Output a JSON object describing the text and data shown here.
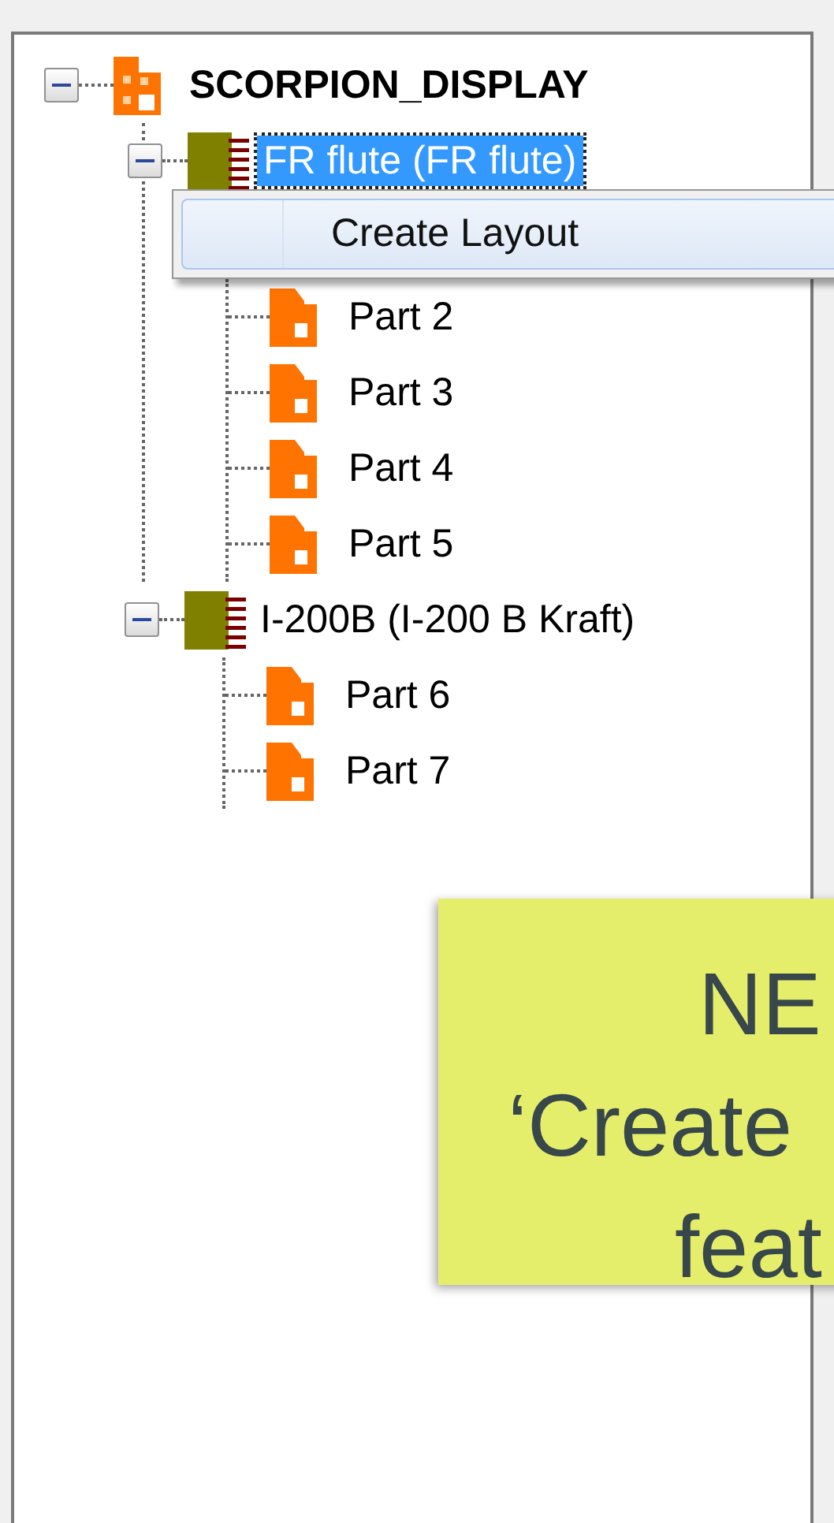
{
  "tree": {
    "label": "SCORPION_DISPLAY",
    "kind": "assembly",
    "expanded": true,
    "selected": false,
    "children": [
      {
        "label": "FR flute (FR flute)",
        "kind": "material",
        "expanded": true,
        "selected": true,
        "children": [
          {
            "label": "Part 2",
            "kind": "part",
            "selected": false
          },
          {
            "label": "Part 3",
            "kind": "part",
            "selected": false
          },
          {
            "label": "Part 4",
            "kind": "part",
            "selected": false
          },
          {
            "label": "Part 5",
            "kind": "part",
            "selected": false
          }
        ]
      },
      {
        "label": "I-200B (I-200 B Kraft)",
        "kind": "material",
        "expanded": true,
        "selected": false,
        "children": [
          {
            "label": "Part 6",
            "kind": "part",
            "selected": false
          },
          {
            "label": "Part 7",
            "kind": "part",
            "selected": false
          }
        ]
      }
    ]
  },
  "context_menu": {
    "items": [
      {
        "label": "Create Layout",
        "selected": true
      }
    ]
  },
  "note": {
    "lines": [
      "NE",
      "‘Create",
      "feat"
    ]
  }
}
